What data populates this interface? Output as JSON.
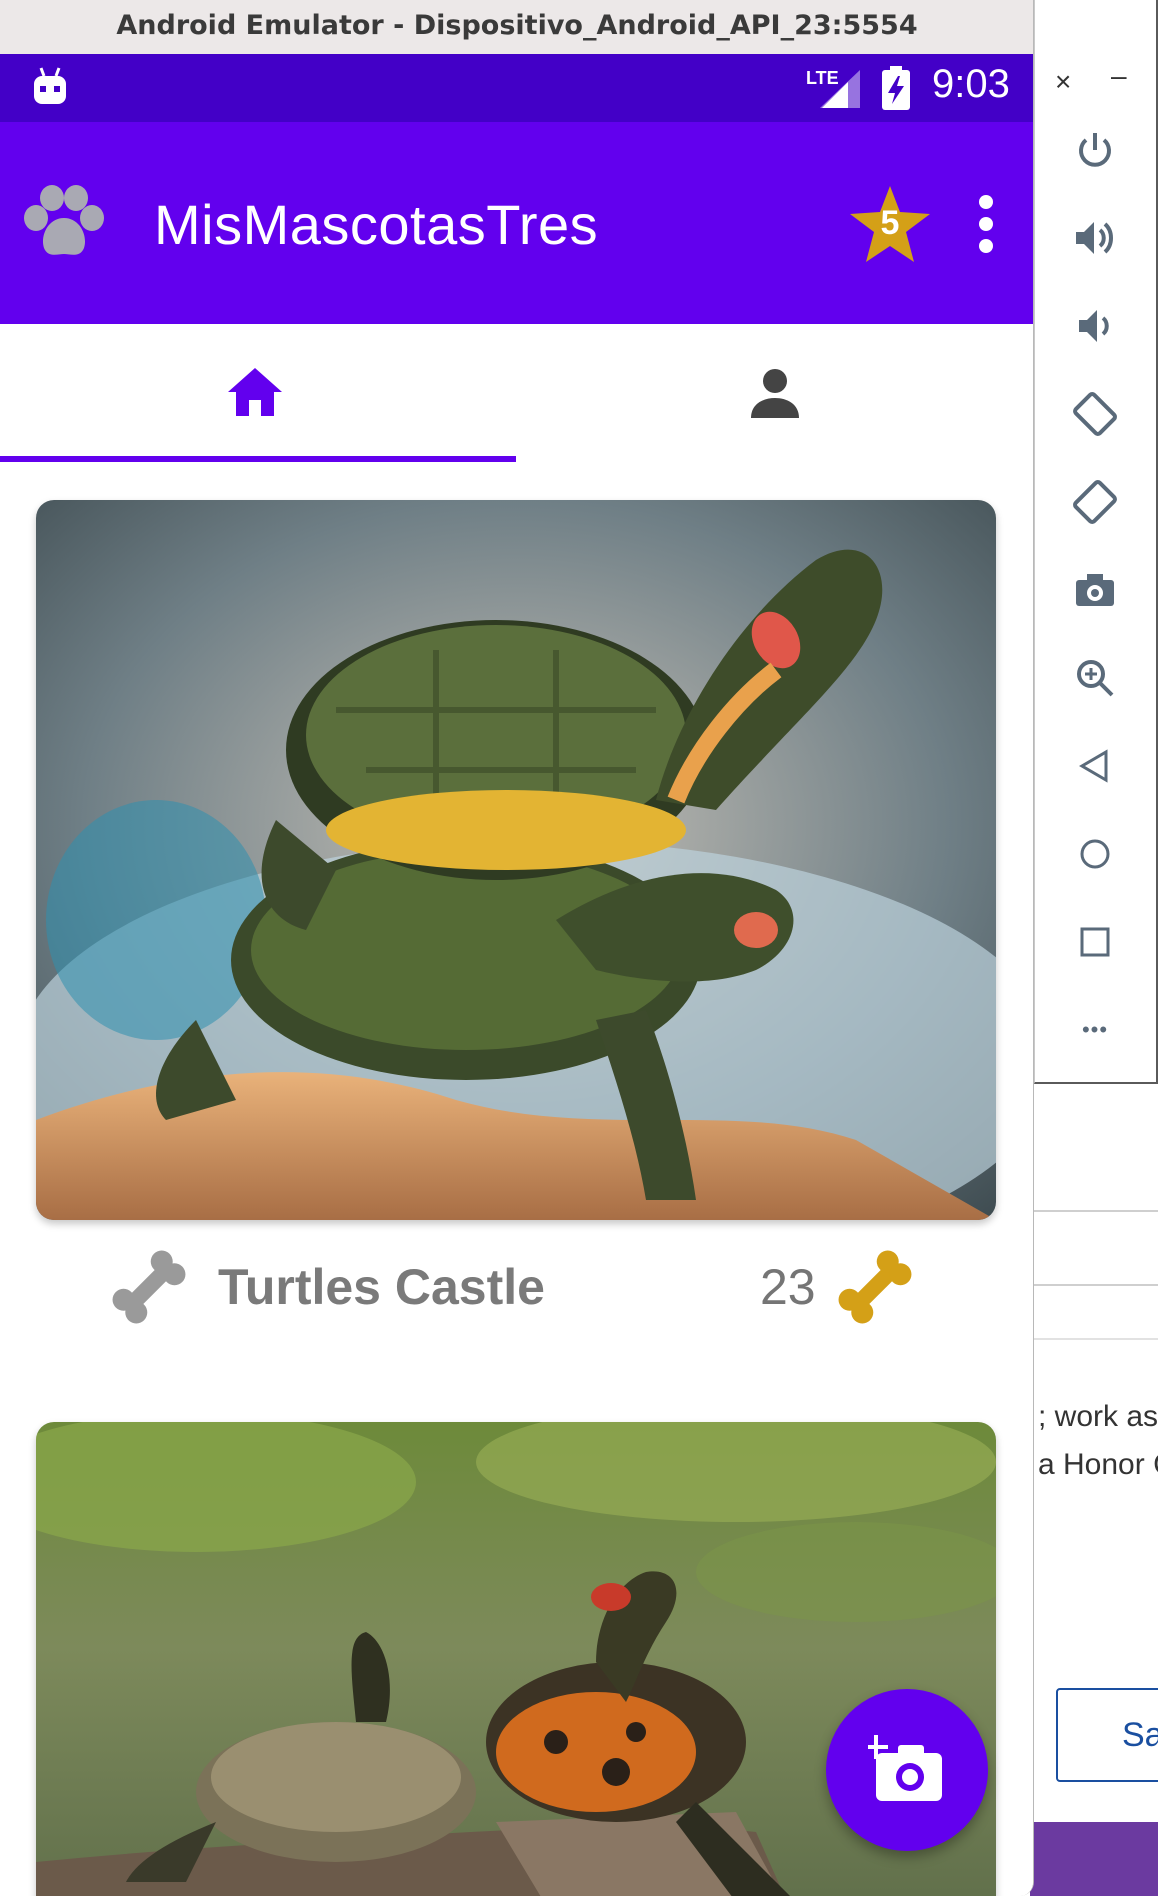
{
  "window": {
    "title": "Android Emulator - Dispositivo_Android_API_23:5554"
  },
  "status_bar": {
    "time": "9:03",
    "network": "LTE"
  },
  "app_bar": {
    "title": "MisMascotasTres",
    "favorites_count": "5",
    "accent_color": "#6200ee",
    "star_color": "#d4a017"
  },
  "tabs": [
    {
      "icon": "home-icon",
      "selected": true
    },
    {
      "icon": "person-icon",
      "selected": false
    }
  ],
  "feed": {
    "cards": [
      {
        "name": "Turtles Castle",
        "likes": "23",
        "photo": "stacked-turtles-photo"
      },
      {
        "name": "",
        "likes": "",
        "photo": "turtles-on-log-photo"
      }
    ]
  },
  "fab": {
    "icon": "add-photo-icon"
  },
  "emulator_toolbar": {
    "close": "×",
    "minimize": "–",
    "buttons": [
      "power-icon",
      "volume-up-icon",
      "volume-down-icon",
      "rotate-left-icon",
      "rotate-right-icon",
      "camera-icon",
      "zoom-icon",
      "back-icon",
      "home-circle-icon",
      "overview-icon",
      "more-icon"
    ],
    "more_label": "•••"
  },
  "background_page": {
    "text_line_1": "; work as r",
    "text_line_2": "a Honor C",
    "button_label": "Sa",
    "star": "☆"
  }
}
